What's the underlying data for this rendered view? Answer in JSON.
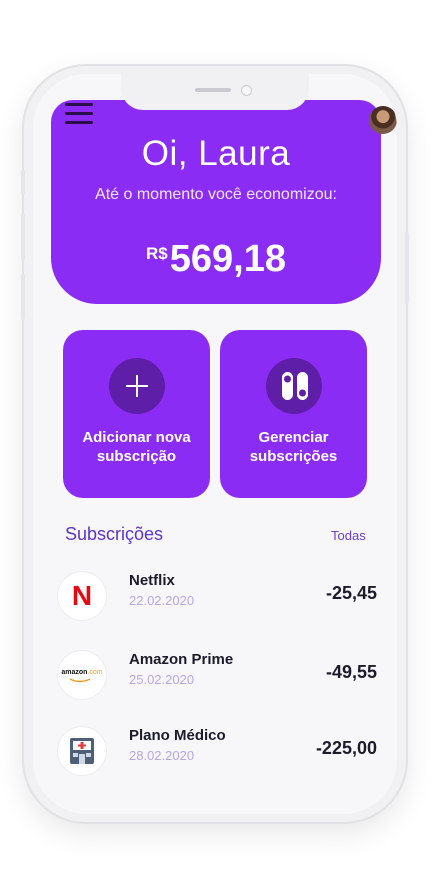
{
  "header": {
    "greeting": "Oi, Laura",
    "subtitle": "Até o momento você economizou:",
    "currency": "R$",
    "amount": "569,18"
  },
  "actions": [
    {
      "label_line1": "Adicionar nova",
      "label_line2": "subscrição",
      "icon": "plus-icon"
    },
    {
      "label_line1": "Gerenciar",
      "label_line2": "subscrições",
      "icon": "manage-icon"
    }
  ],
  "subscriptions": {
    "title": "Subscrições",
    "see_all": "Todas",
    "items": [
      {
        "name": "Netflix",
        "date": "22.02.2020",
        "price": "-25,45",
        "logo_text": "N"
      },
      {
        "name": "Amazon Prime",
        "date": "25.02.2020",
        "price": "-49,55",
        "logo_text": "amazon",
        "logo_suffix": ".com"
      },
      {
        "name": "Plano Médico",
        "date": "28.02.2020",
        "price": "-225,00",
        "logo_text": "hospital-icon"
      }
    ]
  },
  "colors": {
    "accent": "#8b2cf5",
    "accent_dark": "#5f1ea8",
    "heading": "#5a33c9",
    "netflix": "#e50914",
    "amazon_orange": "#f59a1f"
  }
}
